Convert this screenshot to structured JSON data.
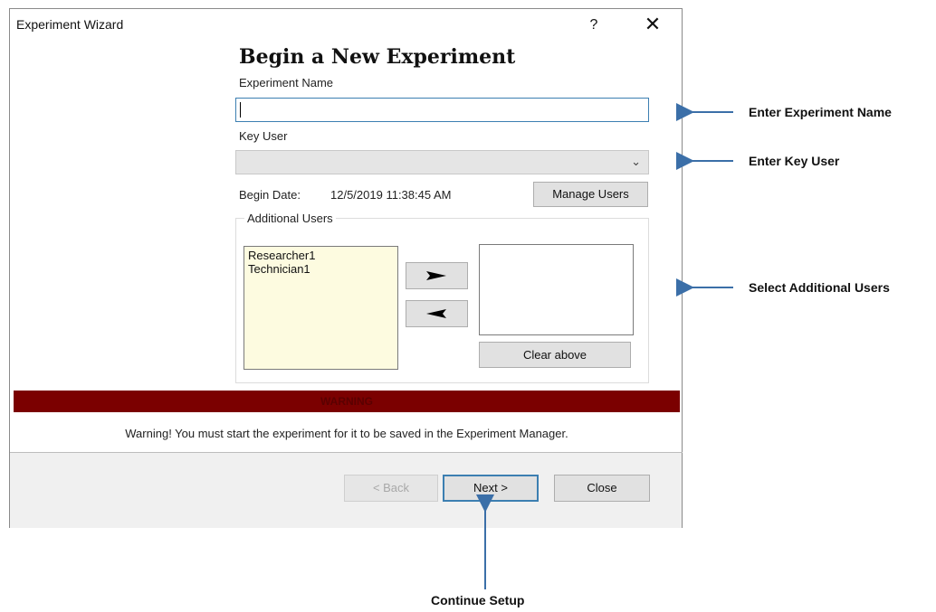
{
  "window": {
    "title": "Experiment Wizard",
    "help_glyph": "?",
    "close_glyph": "✕"
  },
  "form": {
    "heading": "Begin a New Experiment",
    "experiment_name_label": "Experiment Name",
    "experiment_name_value": "",
    "key_user_label": "Key User",
    "key_user_value": "",
    "begin_date_label": "Begin Date:",
    "begin_date_value": "12/5/2019 11:38:45 AM",
    "manage_users_label": "Manage Users"
  },
  "additional_users": {
    "group_label": "Additional Users",
    "available": [
      "Researcher1",
      "Technician1"
    ],
    "selected": [],
    "clear_label": "Clear above"
  },
  "warning": {
    "banner": "WARNING",
    "message": "Warning! You must start the experiment for it to be saved in the Experiment Manager."
  },
  "footer": {
    "back_label": "< Back",
    "next_label": "Next >",
    "close_label": "Close"
  },
  "annotations": {
    "enter_name": "Enter Experiment Name",
    "enter_key_user": "Enter Key User",
    "select_users": "Select Additional Users",
    "continue": "Continue Setup"
  },
  "colors": {
    "warning_bar": "#7b0000",
    "arrow": "#3b6fa8",
    "list_bg": "#fdfbe0"
  }
}
